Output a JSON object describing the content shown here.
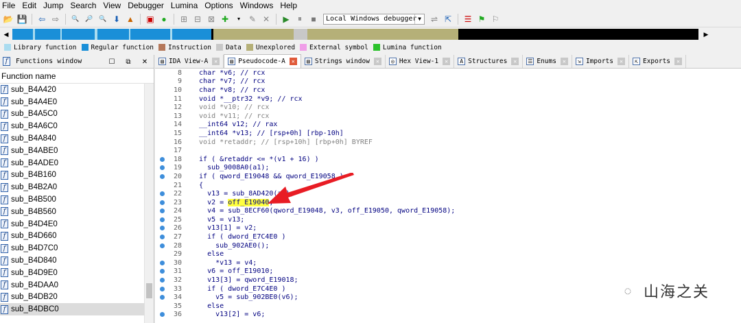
{
  "menu": [
    "File",
    "Edit",
    "Jump",
    "Search",
    "View",
    "Debugger",
    "Lumina",
    "Options",
    "Windows",
    "Help"
  ],
  "toolbar": {
    "debugger_select": "Local Windows debugger"
  },
  "legend": [
    {
      "label": "Library function",
      "color": "#aadcf0"
    },
    {
      "label": "Regular function",
      "color": "#1a8fd8"
    },
    {
      "label": "Instruction",
      "color": "#b5785a"
    },
    {
      "label": "Data",
      "color": "#c8c8c8"
    },
    {
      "label": "Unexplored",
      "color": "#b5b078"
    },
    {
      "label": "External symbol",
      "color": "#f09ee8"
    },
    {
      "label": "Lumina function",
      "color": "#2cc22c"
    }
  ],
  "functions_window": {
    "title": "Functions window",
    "column_header": "Function name",
    "items": [
      "sub_B4A420",
      "sub_B4A4E0",
      "sub_B4A5C0",
      "sub_B4A6C0",
      "sub_B4A840",
      "sub_B4ABE0",
      "sub_B4ADE0",
      "sub_B4B160",
      "sub_B4B2A0",
      "sub_B4B500",
      "sub_B4B560",
      "sub_B4D4E0",
      "sub_B4D660",
      "sub_B4D7C0",
      "sub_B4D840",
      "sub_B4D9E0",
      "sub_B4DAA0",
      "sub_B4DB20",
      "sub_B4DBC0"
    ],
    "selected": "sub_B4DBC0"
  },
  "tabs": [
    {
      "label": "IDA View-A",
      "active": false
    },
    {
      "label": "Pseudocode-A",
      "active": true
    },
    {
      "label": "Strings window",
      "active": false
    },
    {
      "label": "Hex View-1",
      "active": false
    },
    {
      "label": "Structures",
      "active": false
    },
    {
      "label": "Enums",
      "active": false
    },
    {
      "label": "Imports",
      "active": false
    },
    {
      "label": "Exports",
      "active": false
    }
  ],
  "code_lines": [
    {
      "n": "8",
      "dot": false,
      "text": "  char *v6; // rcx"
    },
    {
      "n": "9",
      "dot": false,
      "text": "  char *v7; // rcx"
    },
    {
      "n": "10",
      "dot": false,
      "text": "  char *v8; // rcx"
    },
    {
      "n": "11",
      "dot": false,
      "text": "  void *__ptr32 *v9; // rcx"
    },
    {
      "n": "12",
      "dot": false,
      "text": "  void *v10; // rcx"
    },
    {
      "n": "13",
      "dot": false,
      "text": "  void *v11; // rcx"
    },
    {
      "n": "14",
      "dot": false,
      "text": "  __int64 v12; // rax"
    },
    {
      "n": "15",
      "dot": false,
      "text": "  __int64 *v13; // [rsp+0h] [rbp-10h]"
    },
    {
      "n": "16",
      "dot": false,
      "text": "  void *retaddr; // [rsp+10h] [rbp+0h] BYREF"
    },
    {
      "n": "17",
      "dot": false,
      "text": ""
    },
    {
      "n": "18",
      "dot": true,
      "text": "  if ( &retaddr <= *(v1 + 16) )"
    },
    {
      "n": "19",
      "dot": true,
      "text": "    sub_9008A0(a1);"
    },
    {
      "n": "20",
      "dot": true,
      "text": "  if ( qword_E19048 && qword_E19058 )"
    },
    {
      "n": "21",
      "dot": false,
      "text": "  {"
    },
    {
      "n": "22",
      "dot": true,
      "text": "    v13 = sub_8AD420(a1);"
    },
    {
      "n": "23",
      "dot": true,
      "text": "    v2 = off_E19040;"
    },
    {
      "n": "24",
      "dot": true,
      "text": "    v4 = sub_8ECF60(qword_E19048, v3, off_E19050, qword_E19058);"
    },
    {
      "n": "25",
      "dot": true,
      "text": "    v5 = v13;"
    },
    {
      "n": "26",
      "dot": true,
      "text": "    v13[1] = v2;"
    },
    {
      "n": "27",
      "dot": true,
      "text": "    if ( dword_E7C4E0 )"
    },
    {
      "n": "28",
      "dot": true,
      "text": "      sub_902AE0();"
    },
    {
      "n": "29",
      "dot": false,
      "text": "    else"
    },
    {
      "n": "30",
      "dot": true,
      "text": "      *v13 = v4;"
    },
    {
      "n": "31",
      "dot": true,
      "text": "    v6 = off_E19010;"
    },
    {
      "n": "32",
      "dot": true,
      "text": "    v13[3] = qword_E19018;"
    },
    {
      "n": "33",
      "dot": true,
      "text": "    if ( dword_E7C4E0 )"
    },
    {
      "n": "34",
      "dot": true,
      "text": "      v5 = sub_902BE0(v6);"
    },
    {
      "n": "35",
      "dot": false,
      "text": "    else"
    },
    {
      "n": "36",
      "dot": true,
      "text": "      v13[2] = v6;"
    }
  ],
  "highlight": {
    "line": "23",
    "token": "off_E19040"
  },
  "watermark": "山海之关"
}
